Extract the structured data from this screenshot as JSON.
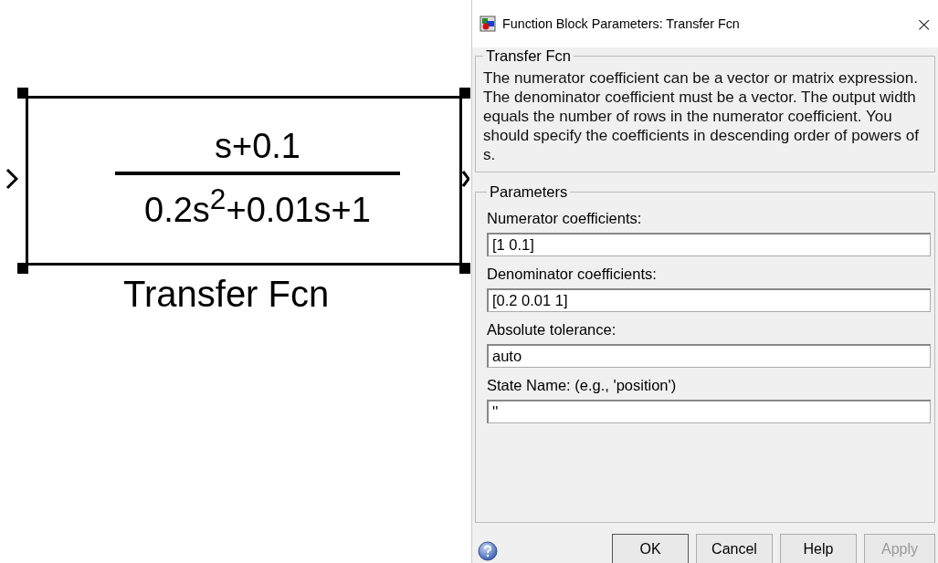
{
  "block": {
    "numerator": "s+0.1",
    "denominator": "0.2s$^{2}$+0.01s+1",
    "label": "Transfer Fcn"
  },
  "dialog": {
    "title": "Function Block Parameters: Transfer Fcn",
    "close": "×",
    "description_group": {
      "title": "Transfer Fcn",
      "text": "The numerator coefficient can be a vector or matrix expression. The denominator coefficient must be a vector. The output width equals the number of rows in the numerator coefficient. You should specify the coefficients in descending order of powers of s."
    },
    "parameters_group": {
      "title": "Parameters",
      "fields": [
        {
          "label": "Numerator coefficients:",
          "value": "[1 0.1]"
        },
        {
          "label": "Denominator coefficients:",
          "value": "[0.2 0.01 1]"
        },
        {
          "label": "Absolute tolerance:",
          "value": "auto"
        },
        {
          "label": "State Name: (e.g., 'position')",
          "value": "''"
        }
      ]
    },
    "buttons": [
      {
        "label": "OK",
        "disabled": false
      },
      {
        "label": "Cancel",
        "disabled": false
      },
      {
        "label": "Help",
        "disabled": false
      },
      {
        "label": "Apply",
        "disabled": true
      }
    ]
  }
}
